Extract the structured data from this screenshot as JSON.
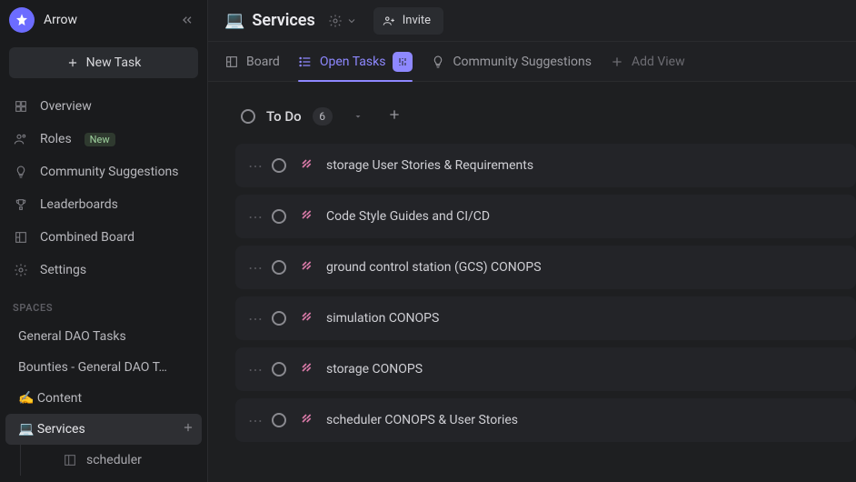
{
  "workspace": {
    "name": "Arrow"
  },
  "sidebar": {
    "new_task_label": "New Task",
    "nav": [
      {
        "label": "Overview"
      },
      {
        "label": "Roles",
        "badge": "New"
      },
      {
        "label": "Community Suggestions"
      },
      {
        "label": "Leaderboards"
      },
      {
        "label": "Combined Board"
      },
      {
        "label": "Settings"
      }
    ],
    "spaces_heading": "SPACES",
    "spaces": [
      {
        "label": "General DAO Tasks"
      },
      {
        "label": "Bounties - General DAO T…"
      },
      {
        "label": "✍️ Content"
      },
      {
        "label": "💻 Services",
        "active": true,
        "has_add": true,
        "children": [
          {
            "label": "scheduler"
          }
        ]
      }
    ]
  },
  "page": {
    "emoji": "💻",
    "title": "Services",
    "invite_label": "Invite"
  },
  "tabs": [
    {
      "label": "Board"
    },
    {
      "label": "Open Tasks",
      "active": true,
      "has_filter_chip": true
    },
    {
      "label": "Community Suggestions"
    },
    {
      "label": "Add View",
      "is_add": true
    }
  ],
  "group": {
    "name": "To Do",
    "count": "6"
  },
  "tasks": [
    {
      "title": "storage User Stories & Requirements"
    },
    {
      "title": "Code Style Guides and CI/CD"
    },
    {
      "title": "ground control station (GCS) CONOPS"
    },
    {
      "title": "simulation CONOPS"
    },
    {
      "title": "storage CONOPS"
    },
    {
      "title": "scheduler CONOPS & User Stories"
    }
  ]
}
